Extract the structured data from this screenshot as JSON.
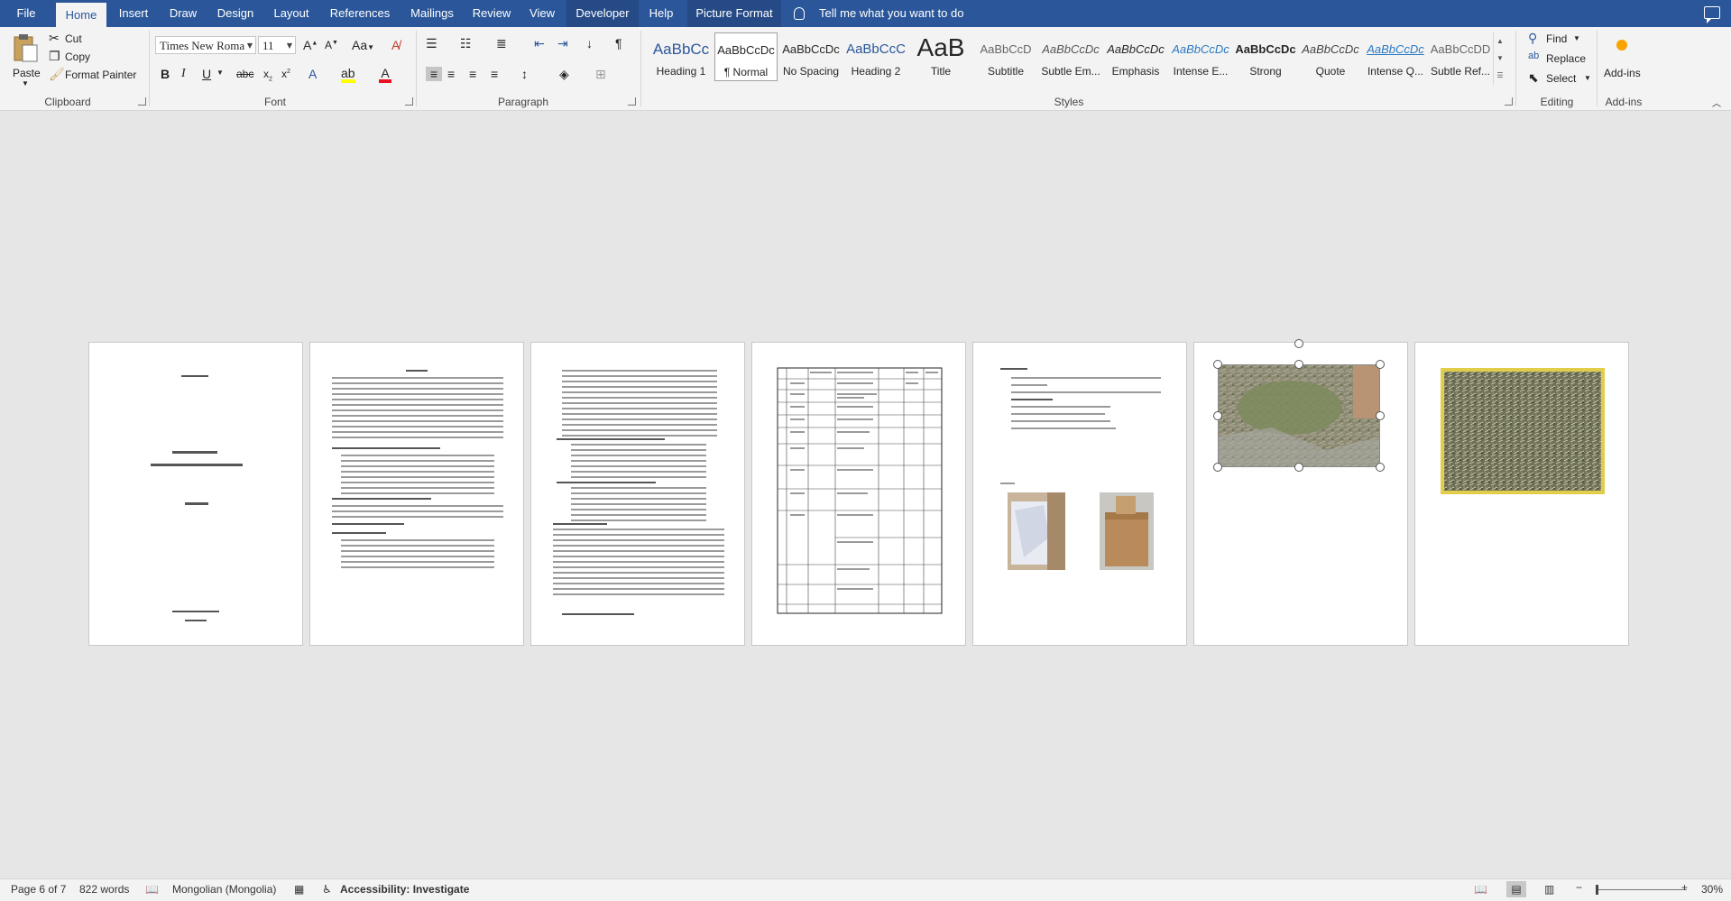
{
  "tabs": {
    "file": "File",
    "home": "Home",
    "insert": "Insert",
    "draw": "Draw",
    "design": "Design",
    "layout": "Layout",
    "references": "References",
    "mailings": "Mailings",
    "review": "Review",
    "view": "View",
    "developer": "Developer",
    "help": "Help",
    "picture_format": "Picture Format",
    "tell_me": "Tell me what you want to do"
  },
  "clipboard": {
    "paste": "Paste",
    "cut": "Cut",
    "copy": "Copy",
    "format_painter": "Format Painter",
    "label": "Clipboard"
  },
  "font": {
    "name": "Times New Roma",
    "size": "11",
    "label": "Font"
  },
  "paragraph": {
    "label": "Paragraph"
  },
  "styles": {
    "label": "Styles",
    "items": [
      {
        "sample": "AaBbCc",
        "name": "Heading 1"
      },
      {
        "sample": "AaBbCcDc",
        "name": "¶ Normal"
      },
      {
        "sample": "AaBbCcDc",
        "name": "No Spacing"
      },
      {
        "sample": "AaBbCcC",
        "name": "Heading 2"
      },
      {
        "sample": "AaB",
        "name": "Title"
      },
      {
        "sample": "AaBbCcD",
        "name": "Subtitle"
      },
      {
        "sample": "AaBbCcDc",
        "name": "Subtle Em..."
      },
      {
        "sample": "AaBbCcDc",
        "name": "Emphasis"
      },
      {
        "sample": "AaBbCcDc",
        "name": "Intense E..."
      },
      {
        "sample": "AaBbCcDc",
        "name": "Strong"
      },
      {
        "sample": "AaBbCcDc",
        "name": "Quote"
      },
      {
        "sample": "AaBbCcDc",
        "name": "Intense Q..."
      },
      {
        "sample": "AaBbCcDD",
        "name": "Subtle Ref..."
      }
    ]
  },
  "editing": {
    "find": "Find",
    "replace": "Replace",
    "select": "Select",
    "label": "Editing"
  },
  "addins": {
    "button": "Add-ins",
    "label": "Add-ins"
  },
  "status": {
    "page": "Page 6 of 7",
    "words": "822 words",
    "language": "Mongolian (Mongolia)",
    "accessibility": "Accessibility: Investigate",
    "zoom": "30%"
  }
}
